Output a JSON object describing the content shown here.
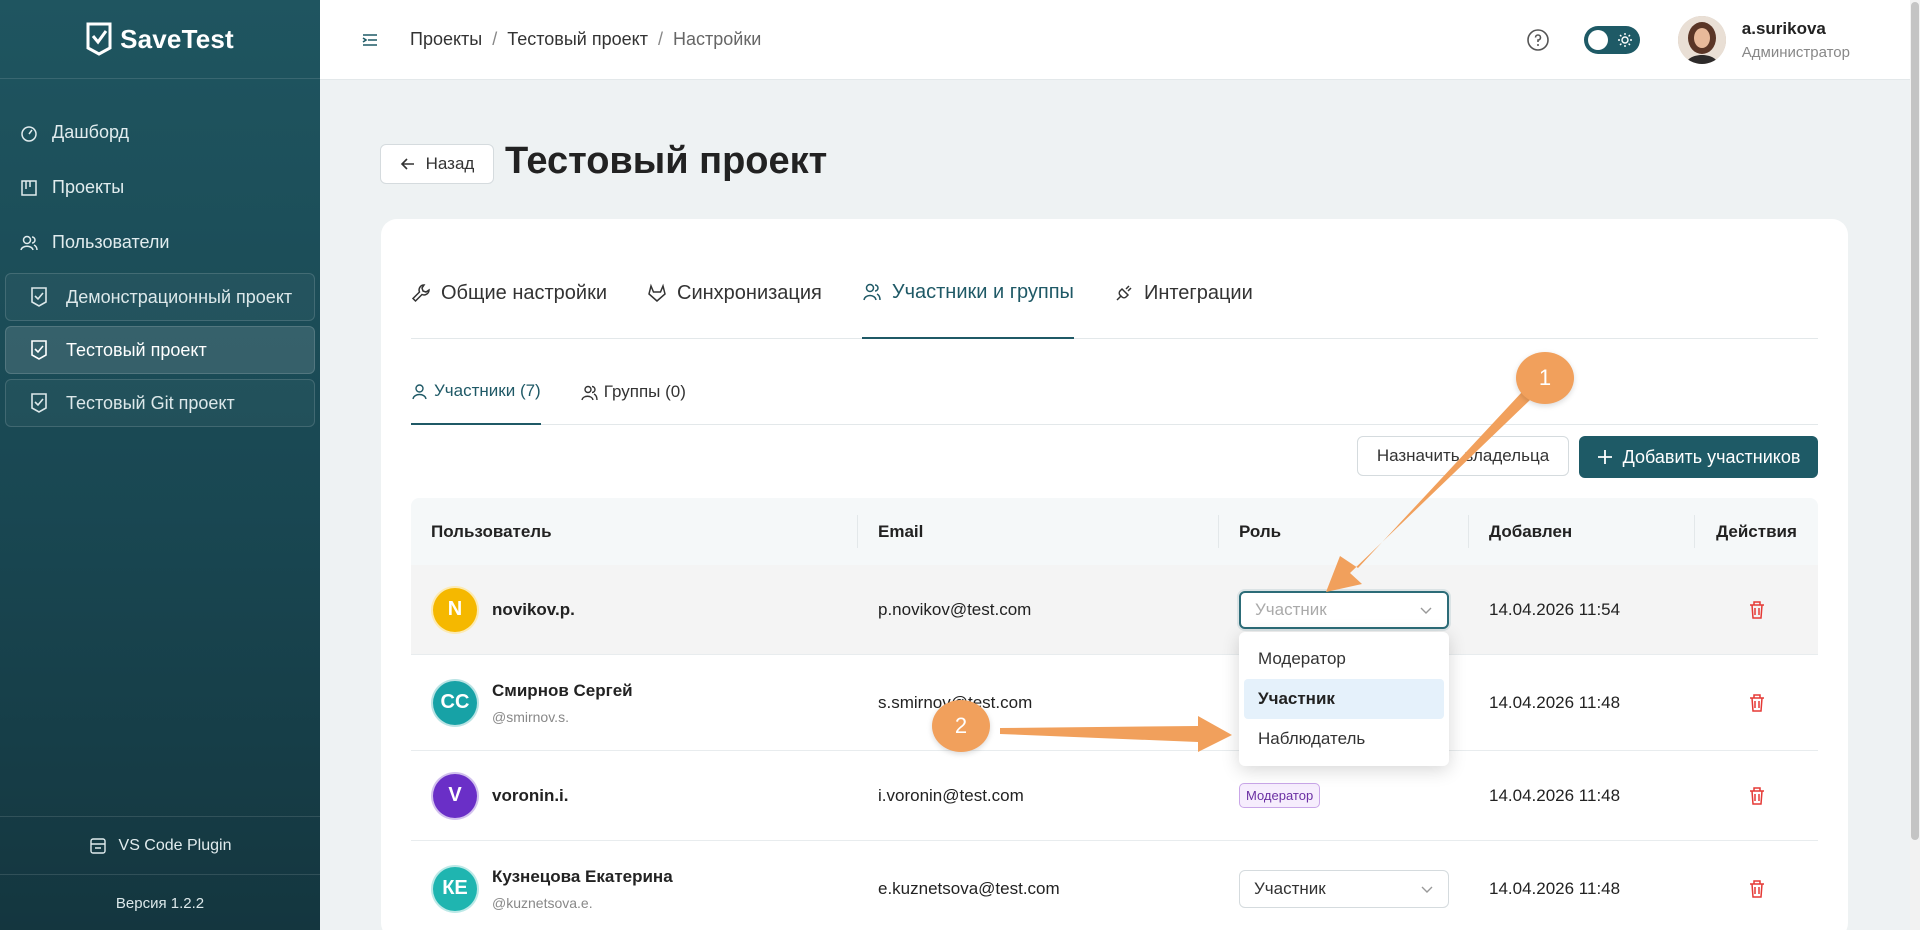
{
  "app": {
    "brand": "SaveTest"
  },
  "sidebar": {
    "nav": [
      {
        "label": "Дашборд",
        "icon": "dashboard-icon"
      },
      {
        "label": "Проекты",
        "icon": "projects-icon"
      },
      {
        "label": "Пользователи",
        "icon": "users-icon"
      }
    ],
    "projects": [
      {
        "label": "Демонстрационный проект",
        "active": false
      },
      {
        "label": "Тестовый проект",
        "active": true
      },
      {
        "label": "Тестовый Git проект",
        "active": false
      }
    ],
    "plugin_label": "VS Code Plugin",
    "version": "Версия 1.2.2"
  },
  "header": {
    "breadcrumb": [
      "Проекты",
      "Тестовый проект",
      "Настройки"
    ],
    "user": {
      "name": "a.surikova",
      "role": "Администратор"
    }
  },
  "page": {
    "back_label": "Назад",
    "title": "Тестовый проект"
  },
  "tabs": [
    {
      "label": "Общие настройки",
      "icon": "wrench-icon",
      "active": false
    },
    {
      "label": "Синхронизация",
      "icon": "gitlab-icon",
      "active": false
    },
    {
      "label": "Участники и группы",
      "icon": "users-icon",
      "active": true
    },
    {
      "label": "Интеграции",
      "icon": "plug-icon",
      "active": false
    }
  ],
  "subtabs": [
    {
      "label": "Участники (7)",
      "active": true
    },
    {
      "label": "Группы (0)",
      "active": false
    }
  ],
  "actions": {
    "assign_owner": "Назначить владельца",
    "add_members": "Добавить участников"
  },
  "table": {
    "headers": {
      "user": "Пользователь",
      "email": "Email",
      "role": "Роль",
      "added": "Добавлен",
      "actions": "Действия"
    },
    "rows": [
      {
        "initials": "N",
        "avatar_color": "#f5b800",
        "name": "novikov.p.",
        "handle": "",
        "email": "p.novikov@test.com",
        "role": "Участник",
        "role_type": "select-open",
        "added": "14.04.2026 11:54"
      },
      {
        "initials": "СС",
        "avatar_color": "#17a2a6",
        "name": "Смирнов Сергей",
        "handle": "@smirnov.s.",
        "email": "s.smirnov@test.com",
        "role": "",
        "role_type": "hidden",
        "added": "14.04.2026 11:48"
      },
      {
        "initials": "V",
        "avatar_color": "#6a2fc7",
        "name": "voronin.i.",
        "handle": "",
        "email": "i.voronin@test.com",
        "role": "Модератор",
        "role_type": "badge",
        "added": "14.04.2026 11:48"
      },
      {
        "initials": "КЕ",
        "avatar_color": "#1fb5b0",
        "name": "Кузнецова Екатерина",
        "handle": "@kuznetsova.e.",
        "email": "e.kuznetsova@test.com",
        "role": "Участник",
        "role_type": "select",
        "added": "14.04.2026 11:48"
      }
    ]
  },
  "role_dropdown": {
    "options": [
      "Модератор",
      "Участник",
      "Наблюдатель"
    ],
    "selected": "Участник"
  },
  "annotations": [
    "1",
    "2"
  ],
  "colors": {
    "accent": "#1e5a66",
    "danger": "#e53935",
    "marker": "#f1a05c"
  }
}
